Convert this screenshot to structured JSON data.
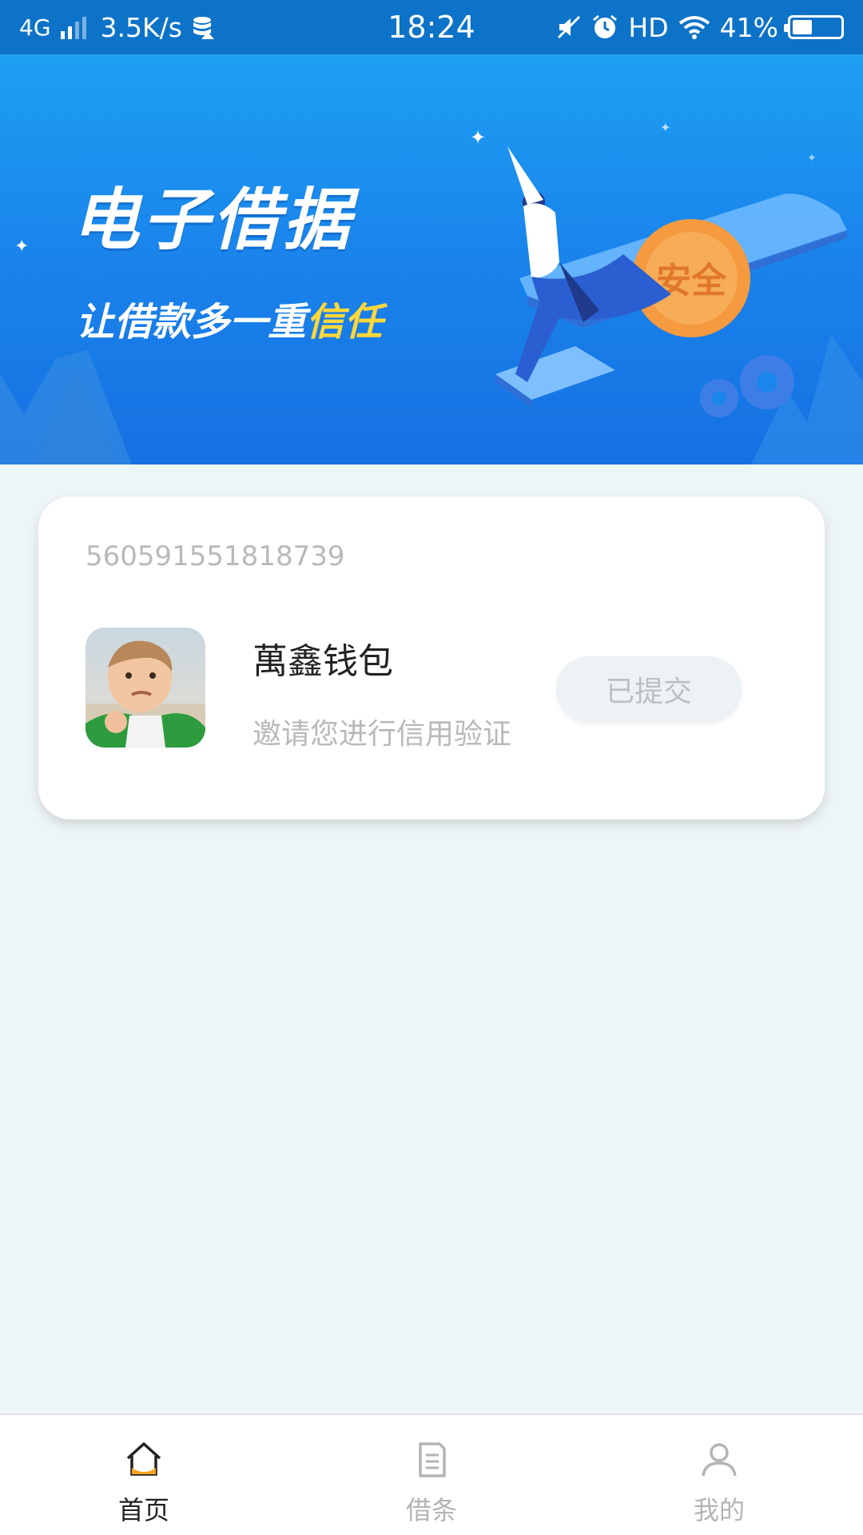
{
  "status_bar": {
    "network": "4G",
    "speed": "3.5K/s",
    "time": "18:24",
    "hd": "HD",
    "battery": "41%",
    "battery_level": 0.41
  },
  "banner": {
    "title": "电子借据",
    "subtitle_main": "让借款多一重",
    "subtitle_highlight": "信任",
    "art_badge_text": "安全",
    "colors": {
      "highlight": "#ffd83a",
      "background": "#1a86ec"
    }
  },
  "card": {
    "id_number": "560591551818739",
    "app_name": "萬鑫钱包",
    "description": "邀请您进行信用验证",
    "status_button_label": "已提交"
  },
  "tabs": [
    {
      "label": "首页",
      "icon": "home-icon",
      "active": true
    },
    {
      "label": "借条",
      "icon": "document-icon",
      "active": false
    },
    {
      "label": "我的",
      "icon": "user-icon",
      "active": false
    }
  ],
  "colors": {
    "accent": "#f5a623",
    "page_background": "#eef5f6",
    "status_bar": "#0d73c8"
  }
}
